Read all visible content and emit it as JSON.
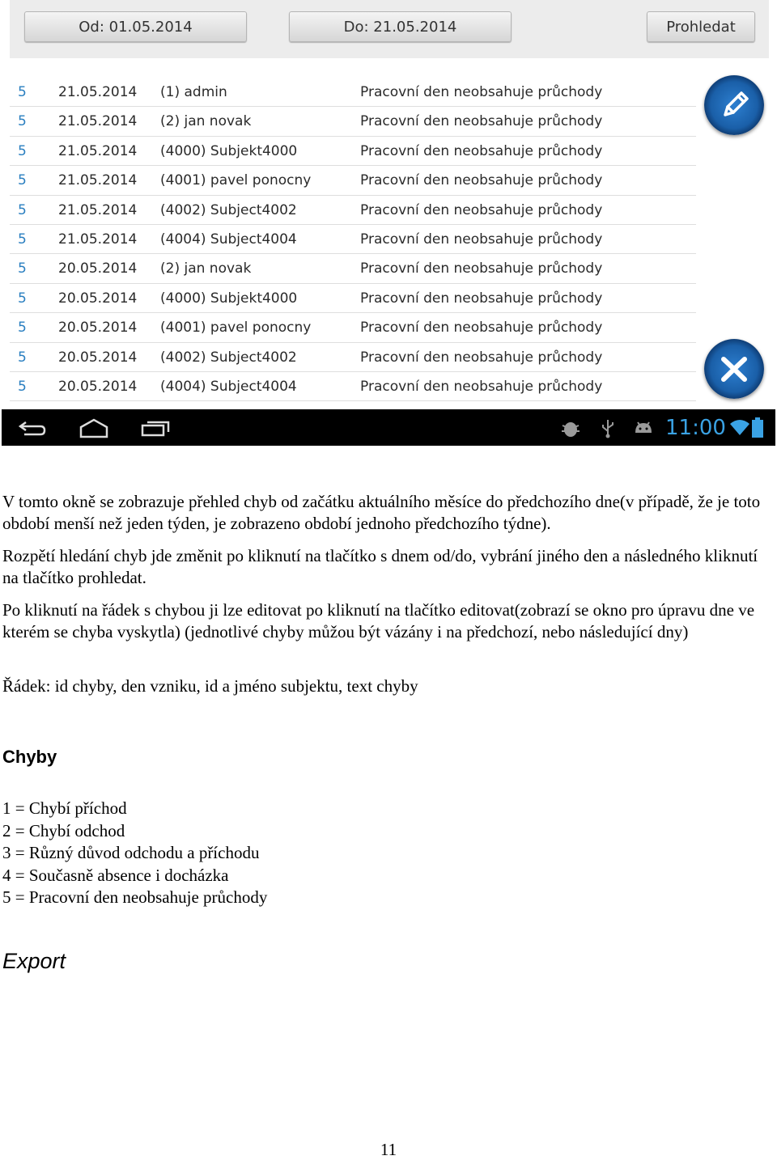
{
  "toolbar": {
    "from_label": "Od: 01.05.2014",
    "to_label": "Do: 21.05.2014",
    "search_label": "Prohledat"
  },
  "errors": [
    {
      "code": "5",
      "date": "21.05.2014",
      "subject": "(1) admin",
      "text": "Pracovní den neobsahuje průchody"
    },
    {
      "code": "5",
      "date": "21.05.2014",
      "subject": "(2) jan novak",
      "text": "Pracovní den neobsahuje průchody"
    },
    {
      "code": "5",
      "date": "21.05.2014",
      "subject": "(4000) Subjekt4000",
      "text": "Pracovní den neobsahuje průchody"
    },
    {
      "code": "5",
      "date": "21.05.2014",
      "subject": "(4001) pavel ponocny",
      "text": "Pracovní den neobsahuje průchody"
    },
    {
      "code": "5",
      "date": "21.05.2014",
      "subject": "(4002) Subject4002",
      "text": "Pracovní den neobsahuje průchody"
    },
    {
      "code": "5",
      "date": "21.05.2014",
      "subject": "(4004) Subject4004",
      "text": "Pracovní den neobsahuje průchody"
    },
    {
      "code": "5",
      "date": "20.05.2014",
      "subject": "(2) jan novak",
      "text": "Pracovní den neobsahuje průchody"
    },
    {
      "code": "5",
      "date": "20.05.2014",
      "subject": "(4000) Subjekt4000",
      "text": "Pracovní den neobsahuje průchody"
    },
    {
      "code": "5",
      "date": "20.05.2014",
      "subject": "(4001) pavel ponocny",
      "text": "Pracovní den neobsahuje průchody"
    },
    {
      "code": "5",
      "date": "20.05.2014",
      "subject": "(4002) Subject4002",
      "text": "Pracovní den neobsahuje průchody"
    },
    {
      "code": "5",
      "date": "20.05.2014",
      "subject": "(4004) Subject4004",
      "text": "Pracovní den neobsahuje průchody"
    }
  ],
  "statusbar": {
    "time": "11:00",
    "accent": "#3aa2e4"
  },
  "icons": {
    "edit": "pencil-icon",
    "cancel": "close-icon",
    "back": "back-icon",
    "home": "home-icon",
    "recent": "recent-apps-icon"
  },
  "doc": {
    "p1": "V tomto okně se zobrazuje přehled chyb od začátku aktuálního měsíce do předchozího dne(v případě, že je toto období menší než jeden týden, je zobrazeno období jednoho předchozího týdne).",
    "p2": "Rozpětí hledání chyb jde změnit po kliknutí na tlačítko s dnem od/do, vybrání jiného den a následného kliknutí na tlačítko prohledat.",
    "p3": "Po kliknutí na řádek s chybou ji lze editovat po kliknutí na tlačítko editovat(zobrazí se okno pro úpravu dne ve kterém se chyba vyskytla) (jednotlivé chyby můžou být vázány i na předchozí, nebo následující dny)",
    "p4": "Řádek: id chyby, den vzniku, id a jméno subjektu, text chyby",
    "heading": "Chyby",
    "legend": [
      "1 = Chybí příchod",
      "2 = Chybí odchod",
      "3 = Různý důvod odchodu a příchodu",
      "4 = Současně absence i docházka",
      "5 = Pracovní den neobsahuje průchody"
    ],
    "export": "Export",
    "page_number": "11"
  }
}
